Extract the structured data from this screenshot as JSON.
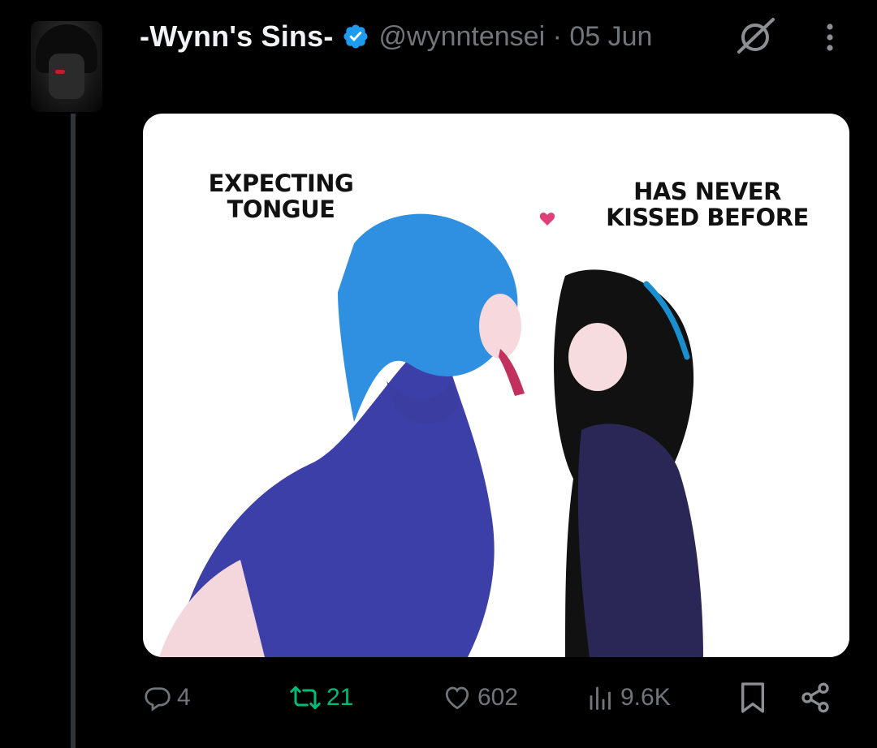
{
  "post": {
    "author_name": "-Wynn's Sins-",
    "handle_date": "@wynntensei · 05 Jun",
    "verified": true,
    "media": {
      "caption_left": "EXPECTING TONGUE",
      "caption_right": "HAS NEVER KISSED BEFORE"
    },
    "actions": {
      "replies": "4",
      "reposts": "21",
      "likes": "602",
      "views": "9.6K"
    }
  },
  "icons": [
    "grok-icon",
    "more-icon",
    "reply-icon",
    "repost-icon",
    "like-icon",
    "views-icon",
    "bookmark-icon",
    "share-icon"
  ],
  "colors": {
    "background": "#000000",
    "text": "#e7e9ea",
    "muted": "#71767b",
    "verified": "#1d9bf0",
    "repost": "#00ba7c"
  }
}
